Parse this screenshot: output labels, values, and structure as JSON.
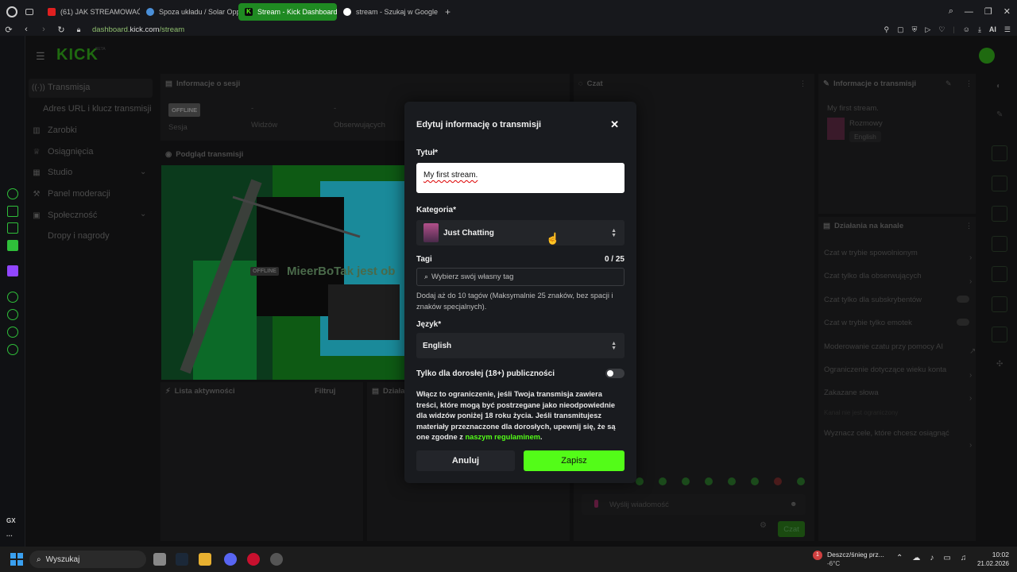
{
  "browser": {
    "tabs": [
      {
        "label": "(61) JAK STREAMOWAĆ N",
        "icon": "youtube-icon",
        "color": "#e02020"
      },
      {
        "label": "Spoza układu / Solar Opp",
        "icon": "globe-icon",
        "color": "#4a8fd8"
      },
      {
        "label": "Stream - Kick Dashboard",
        "icon": "kick-icon",
        "color": "#53fc18",
        "active": true
      },
      {
        "label": "stream - Szukaj w Google",
        "icon": "google-icon",
        "color": "#ffffff"
      }
    ],
    "new_tab": "+",
    "url_host": "dashboard.",
    "url_domain": "kick.com",
    "url_path": "/stream",
    "ai_label": "AI"
  },
  "gx_sidebar": {
    "gx_label": "GX",
    "more": "···"
  },
  "dashboard": {
    "logo": "KICK",
    "logo_badge": "BETA",
    "nav": [
      {
        "label": "Transmisja",
        "icon": "broadcast-icon"
      },
      {
        "label": "Adres URL i klucz transmisji",
        "icon": ""
      },
      {
        "label": "Zarobki",
        "icon": "chart-icon"
      },
      {
        "label": "Osiągnięcia",
        "icon": "trophy-icon"
      },
      {
        "label": "Studio",
        "icon": "studio-icon"
      },
      {
        "label": "Panel moderacji",
        "icon": "hammer-icon"
      },
      {
        "label": "Społeczność",
        "icon": "community-icon"
      },
      {
        "label": "Dropy i nagrody",
        "icon": "gift-icon"
      }
    ],
    "session": {
      "title": "Informacje o sesji",
      "status": "OFFLINE",
      "stats": [
        {
          "value": "-",
          "label": "Sesja"
        },
        {
          "value": "-",
          "label": "Widzów"
        },
        {
          "value": "-",
          "label": "Obserwujących"
        }
      ]
    },
    "preview": {
      "title": "Podgląd transmisji",
      "offline_badge": "OFFLINE",
      "offline_text": "MieerBoTak jest ob"
    },
    "activity": {
      "title": "Lista aktywności",
      "filter": "Filtruj",
      "actions_title": "Działa"
    },
    "chat": {
      "title": "Czat",
      "placeholder": "Wyślij wiadomość",
      "send": "Czat"
    },
    "stream_info": {
      "title": "Informacje o transmisji",
      "stream_title": "My first stream.",
      "category": "Rozmowy",
      "language": "English"
    },
    "channel_actions": {
      "title": "Działania na kanale",
      "items": [
        "Czat w trybie spowolnionym",
        "Czat tylko dla obserwujących",
        "Czat tylko dla subskrybentów",
        "Czat w trybie tylko emotek",
        "Moderowanie czatu przy pomocy AI",
        "Ograniczenie dotyczące wieku konta",
        "Zakazane słowa",
        "Kanał nie jest ograniczony",
        "Wyznacz cele, które chcesz osiągnąć"
      ]
    }
  },
  "modal": {
    "title": "Edytuj informację o transmisji",
    "close": "✕",
    "title_label": "Tytuł*",
    "title_value": "My first stream.",
    "category_label": "Kategoria*",
    "category_value": "Just Chatting",
    "tags_label": "Tagi",
    "tags_count": "0 / 25",
    "tags_placeholder": "Wybierz swój własny tag",
    "tags_help": "Dodaj aż do 10 tagów (Maksymalnie 25 znaków, bez spacji i znaków specjalnych).",
    "language_label": "Język*",
    "language_value": "English",
    "adult_label": "Tylko dla dorosłej (18+) publiczności",
    "adult_enabled": false,
    "adult_help": "Włącz to ograniczenie, jeśli Twoja transmisja zawiera treści, które mogą być postrzegane jako nieodpowiednie dla widzów poniżej 18 roku życia. Jeśli transmitujesz materiały przeznaczone dla dorosłych, upewnij się, że są one zgodne z",
    "adult_help_link": "naszym regulaminem",
    "adult_help_end": ".",
    "cancel": "Anuluj",
    "save": "Zapisz"
  },
  "taskbar": {
    "search_placeholder": "Wyszukaj",
    "weather_title": "Deszcz/śnieg prz...",
    "weather_temp": "-6°C",
    "weather_badge": "1",
    "time": "10:02",
    "date": "21.02.2026"
  },
  "colors": {
    "accent": "#53fc18",
    "modal_bg": "#191b1f",
    "page_bg": "#0f0f10"
  }
}
